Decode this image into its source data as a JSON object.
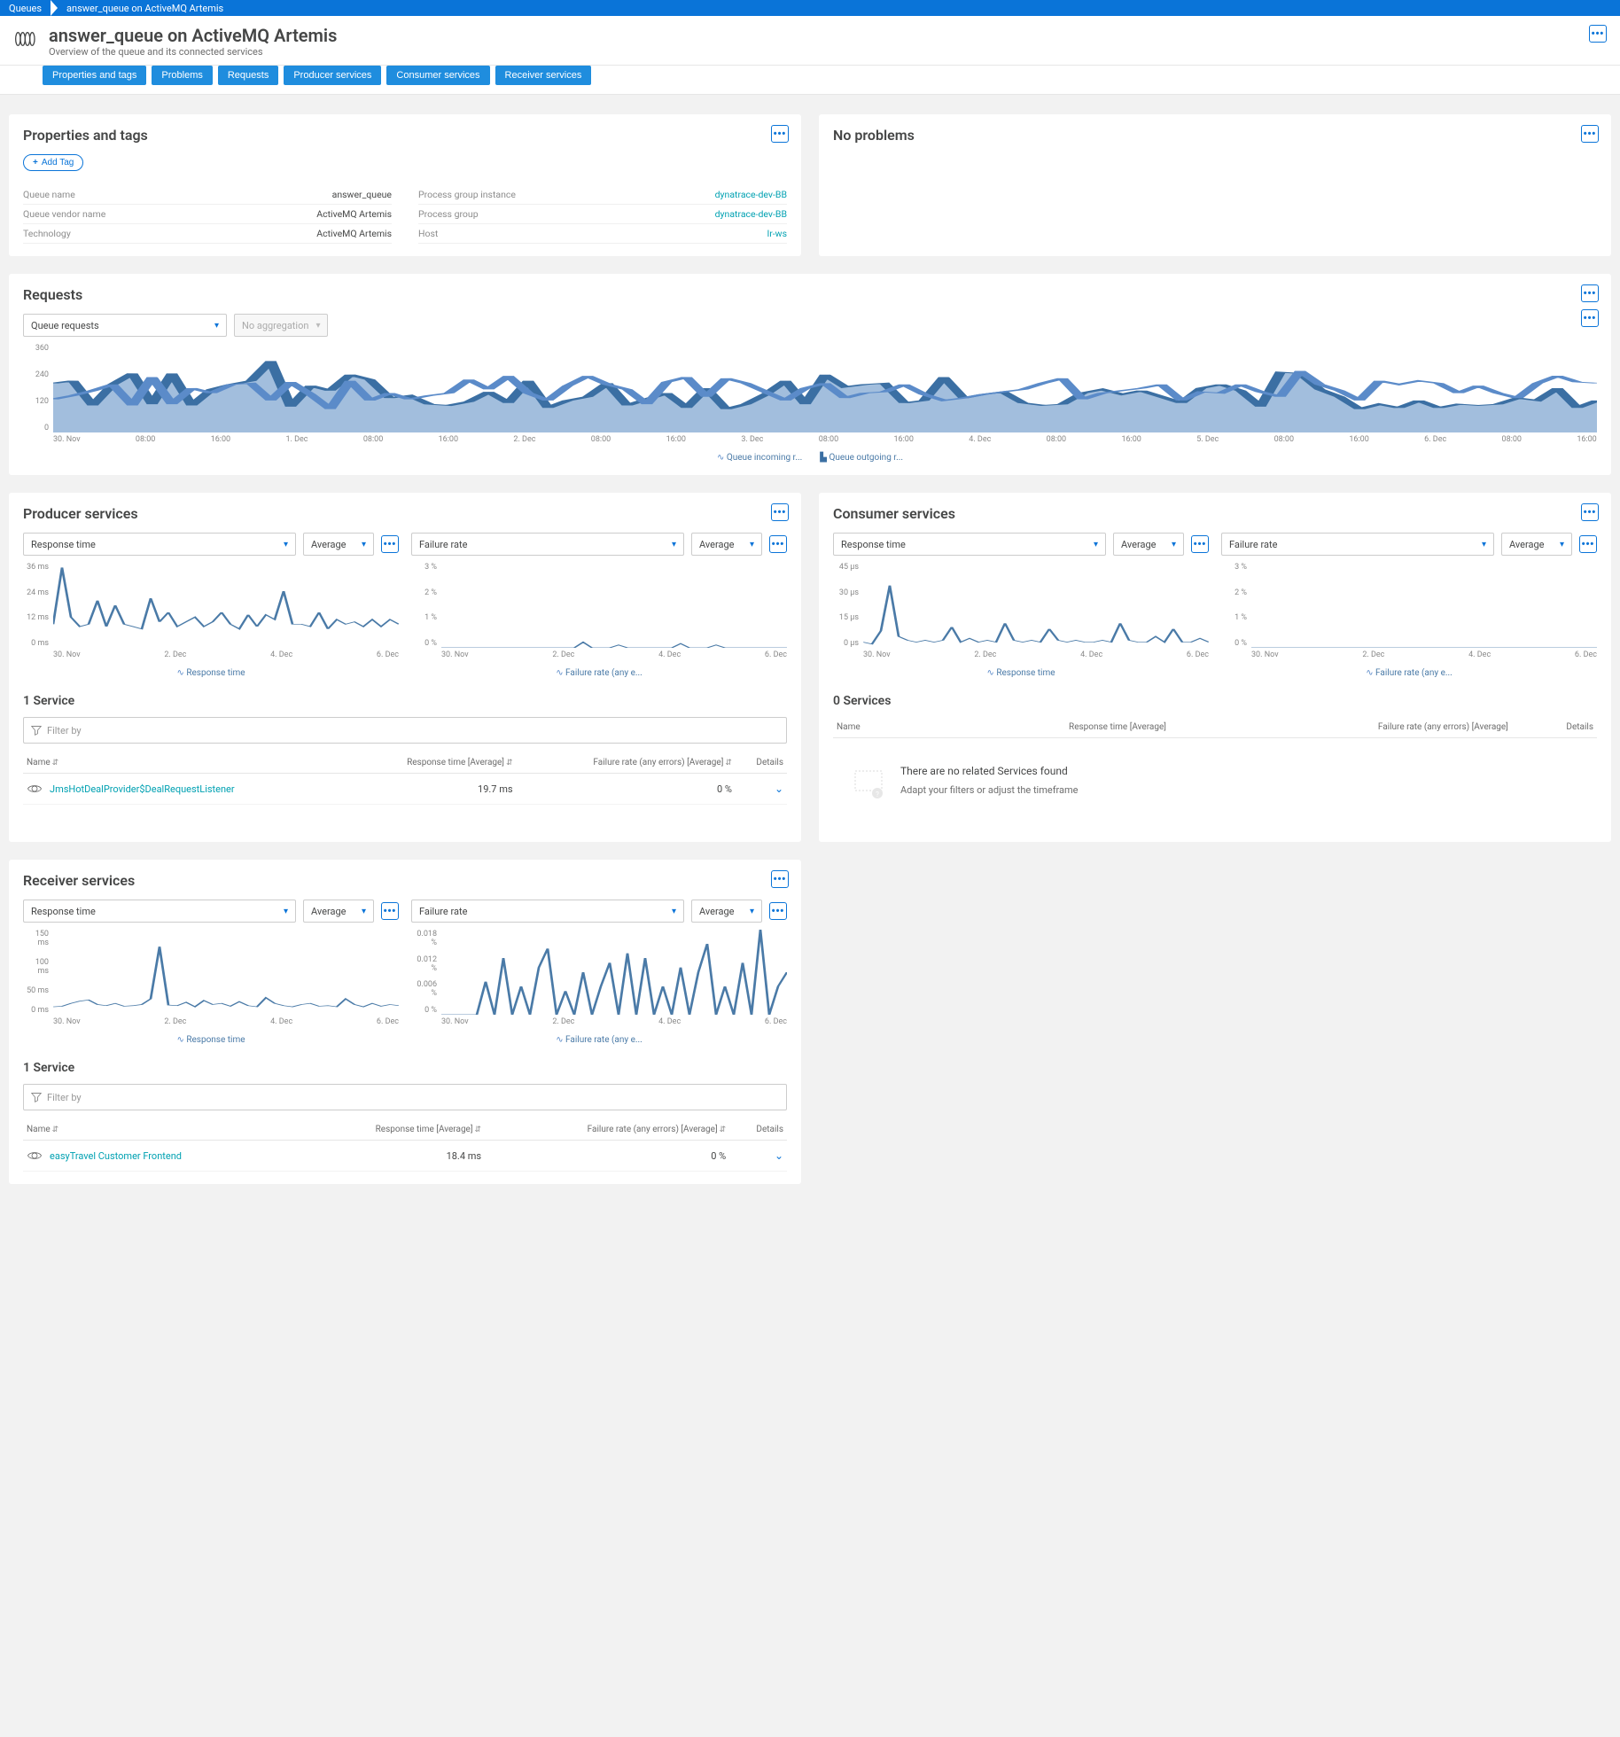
{
  "breadcrumb": {
    "root": "Queues",
    "current": "answer_queue on ActiveMQ Artemis"
  },
  "header": {
    "title": "answer_queue on ActiveMQ Artemis",
    "subtitle": "Overview of the queue and its connected services"
  },
  "tabs": [
    "Properties and tags",
    "Problems",
    "Requests",
    "Producer services",
    "Consumer services",
    "Receiver services"
  ],
  "properties": {
    "title": "Properties and tags",
    "add_tag": "Add Tag",
    "rows_left": [
      {
        "label": "Queue name",
        "value": "answer_queue"
      },
      {
        "label": "Queue vendor name",
        "value": "ActiveMQ Artemis"
      },
      {
        "label": "Technology",
        "value": "ActiveMQ Artemis"
      }
    ],
    "rows_right": [
      {
        "label": "Process group instance",
        "value": "dynatrace-dev-BB",
        "link": true
      },
      {
        "label": "Process group",
        "value": "dynatrace-dev-BB",
        "link": true
      },
      {
        "label": "Host",
        "value": "lr-ws",
        "link": true
      }
    ]
  },
  "problems": {
    "title": "No problems"
  },
  "requests": {
    "title": "Requests",
    "selector": "Queue requests",
    "aggregation": "No aggregation",
    "legend_in": "Queue incoming r...",
    "legend_out": "Queue outgoing r...",
    "chart_data": {
      "type": "area",
      "ylim": [
        0,
        360
      ],
      "yticks": [
        0,
        120,
        240,
        360
      ],
      "xticks": [
        "30. Nov",
        "08:00",
        "16:00",
        "1. Dec",
        "08:00",
        "16:00",
        "2. Dec",
        "08:00",
        "16:00",
        "3. Dec",
        "08:00",
        "16:00",
        "4. Dec",
        "08:00",
        "16:00",
        "5. Dec",
        "08:00",
        "16:00",
        "6. Dec",
        "08:00",
        "16:00"
      ],
      "series": [
        {
          "name": "outgoing",
          "style": "area",
          "values": [
            200,
            210,
            110,
            195,
            240,
            115,
            240,
            110,
            175,
            195,
            210,
            290,
            105,
            190,
            170,
            235,
            215,
            140,
            150,
            115,
            110,
            125,
            165,
            120,
            210,
            100,
            130,
            145,
            200,
            110,
            135,
            160,
            100,
            180,
            95,
            115,
            155,
            210,
            115,
            235,
            185,
            195,
            200,
            120,
            130,
            225,
            140,
            155,
            165,
            120,
            110,
            115,
            160,
            175,
            155,
            170,
            145,
            120,
            180,
            195,
            170,
            105,
            245,
            240,
            175,
            145,
            95,
            115,
            100,
            130,
            100,
            115,
            110,
            115,
            140,
            130,
            180,
            100,
            130
          ]
        },
        {
          "name": "incoming",
          "style": "line",
          "values": [
            135,
            150,
            170,
            195,
            110,
            225,
            115,
            180,
            160,
            195,
            200,
            130,
            205,
            155,
            95,
            210,
            130,
            160,
            135,
            150,
            160,
            215,
            175,
            230,
            160,
            130,
            190,
            230,
            195,
            175,
            115,
            205,
            225,
            145,
            220,
            200,
            165,
            130,
            180,
            200,
            140,
            160,
            165,
            195,
            155,
            130,
            140,
            155,
            165,
            175,
            200,
            220,
            135,
            160,
            170,
            180,
            195,
            130,
            165,
            160,
            195,
            165,
            145,
            250,
            195,
            170,
            130,
            210,
            195,
            210,
            200,
            160,
            190,
            160,
            140,
            200,
            230,
            205,
            200
          ]
        }
      ]
    }
  },
  "producer": {
    "title": "Producer services",
    "metric1": "Response time",
    "agg1": "Average",
    "metric2": "Failure rate",
    "agg2": "Average",
    "legend1": "Response time",
    "legend2": "Failure rate (any e...",
    "chart1": {
      "type": "line",
      "ylim": [
        0,
        36
      ],
      "yticks": [
        "0 ms",
        "12 ms",
        "24 ms",
        "36 ms"
      ],
      "xticks": [
        "30. Nov",
        "2. Dec",
        "4. Dec",
        "6. Dec"
      ],
      "values": [
        10,
        34,
        13,
        9,
        10,
        20,
        9,
        18,
        10,
        9,
        8,
        21,
        11,
        15,
        9,
        11,
        13,
        9,
        11,
        15,
        10,
        8,
        14,
        9,
        14,
        12,
        24,
        10,
        10,
        9,
        15,
        8,
        12,
        10,
        11,
        9,
        12,
        9,
        12,
        10
      ]
    },
    "chart2": {
      "type": "line",
      "ylim": [
        0,
        3
      ],
      "yticks": [
        "0 %",
        "1 %",
        "2 %",
        "3 %"
      ],
      "xticks": [
        "30. Nov",
        "2. Dec",
        "4. Dec",
        "6. Dec"
      ],
      "values": [
        0,
        0,
        0,
        0,
        0,
        0,
        0,
        0,
        0,
        0,
        0,
        0,
        0,
        0,
        0,
        0,
        0.2,
        0,
        0,
        0,
        0.1,
        0,
        0,
        0,
        0,
        0,
        0,
        0.15,
        0,
        0,
        0,
        0.1,
        0,
        0,
        0,
        0,
        0,
        0,
        0,
        0
      ]
    },
    "service_count": "1 Service",
    "filter": "Filter by",
    "columns": {
      "name": "Name",
      "rt": "Response time [Average]",
      "fr": "Failure rate (any errors) [Average]",
      "details": "Details"
    },
    "rows": [
      {
        "name": "JmsHotDealProvider$DealRequestListener",
        "rt": "19.7 ms",
        "fr": "0 %"
      }
    ]
  },
  "consumer": {
    "title": "Consumer services",
    "metric1": "Response time",
    "agg1": "Average",
    "metric2": "Failure rate",
    "agg2": "Average",
    "legend1": "Response time",
    "legend2": "Failure rate (any e...",
    "chart1": {
      "type": "line",
      "ylim": [
        0,
        45
      ],
      "yticks": [
        "0 µs",
        "15 µs",
        "30 µs",
        "45 µs"
      ],
      "xticks": [
        "30. Nov",
        "2. Dec",
        "4. Dec",
        "6. Dec"
      ],
      "values": [
        3,
        2,
        9,
        33,
        6,
        4,
        3,
        4,
        3,
        4,
        11,
        3,
        5,
        3,
        4,
        3,
        13,
        4,
        3,
        4,
        3,
        10,
        4,
        3,
        4,
        3,
        3,
        4,
        3,
        13,
        4,
        3,
        3,
        6,
        3,
        10,
        3,
        3,
        5,
        3
      ]
    },
    "chart2": {
      "type": "line",
      "ylim": [
        0,
        3
      ],
      "yticks": [
        "0 %",
        "1 %",
        "2 %",
        "3 %"
      ],
      "xticks": [
        "30. Nov",
        "2. Dec",
        "4. Dec",
        "6. Dec"
      ],
      "values": [
        0,
        0,
        0,
        0,
        0,
        0,
        0,
        0,
        0,
        0,
        0,
        0,
        0,
        0,
        0,
        0,
        0,
        0,
        0,
        0,
        0,
        0,
        0,
        0,
        0,
        0,
        0,
        0,
        0,
        0,
        0,
        0,
        0,
        0,
        0,
        0,
        0,
        0,
        0,
        0
      ]
    },
    "service_count": "0 Services",
    "columns": {
      "name": "Name",
      "rt": "Response time [Average]",
      "fr": "Failure rate (any errors) [Average]",
      "details": "Details"
    },
    "empty": {
      "title": "There are no related Services found",
      "sub": "Adapt your filters or adjust the timeframe"
    }
  },
  "receiver": {
    "title": "Receiver services",
    "metric1": "Response time",
    "agg1": "Average",
    "metric2": "Failure rate",
    "agg2": "Average",
    "legend1": "Response time",
    "legend2": "Failure rate (any e...",
    "chart1": {
      "type": "line",
      "ylim": [
        0,
        150
      ],
      "yticks": [
        "0 ms",
        "50 ms",
        "100 ms",
        "150 ms"
      ],
      "xticks": [
        "30. Nov",
        "2. Dec",
        "4. Dec",
        "6. Dec"
      ],
      "values": [
        14,
        15,
        20,
        24,
        26,
        18,
        16,
        20,
        15,
        16,
        18,
        28,
        120,
        17,
        16,
        22,
        14,
        25,
        18,
        20,
        15,
        23,
        16,
        14,
        30,
        20,
        16,
        14,
        18,
        20,
        15,
        16,
        14,
        28,
        18,
        14,
        20,
        15,
        18,
        16
      ]
    },
    "chart2": {
      "type": "line",
      "ylim": [
        0,
        0.018
      ],
      "yticks": [
        "0 %",
        "0.006 %",
        "0.012 %",
        "0.018 %"
      ],
      "xticks": [
        "30. Nov",
        "2. Dec",
        "4. Dec",
        "6. Dec"
      ],
      "values": [
        0,
        0,
        0,
        0,
        0,
        0.007,
        0,
        0.012,
        0,
        0.006,
        0,
        0.01,
        0.014,
        0,
        0.005,
        0,
        0.009,
        0,
        0.006,
        0.011,
        0,
        0.013,
        0,
        0.012,
        0,
        0.006,
        0,
        0.01,
        0,
        0.009,
        0.015,
        0,
        0.006,
        0,
        0.011,
        0,
        0.018,
        0,
        0.006,
        0.009
      ]
    },
    "service_count": "1 Service",
    "filter": "Filter by",
    "columns": {
      "name": "Name",
      "rt": "Response time [Average]",
      "fr": "Failure rate (any errors) [Average]",
      "details": "Details"
    },
    "rows": [
      {
        "name": "easyTravel Customer Frontend",
        "rt": "18.4 ms",
        "fr": "0 %"
      }
    ]
  }
}
